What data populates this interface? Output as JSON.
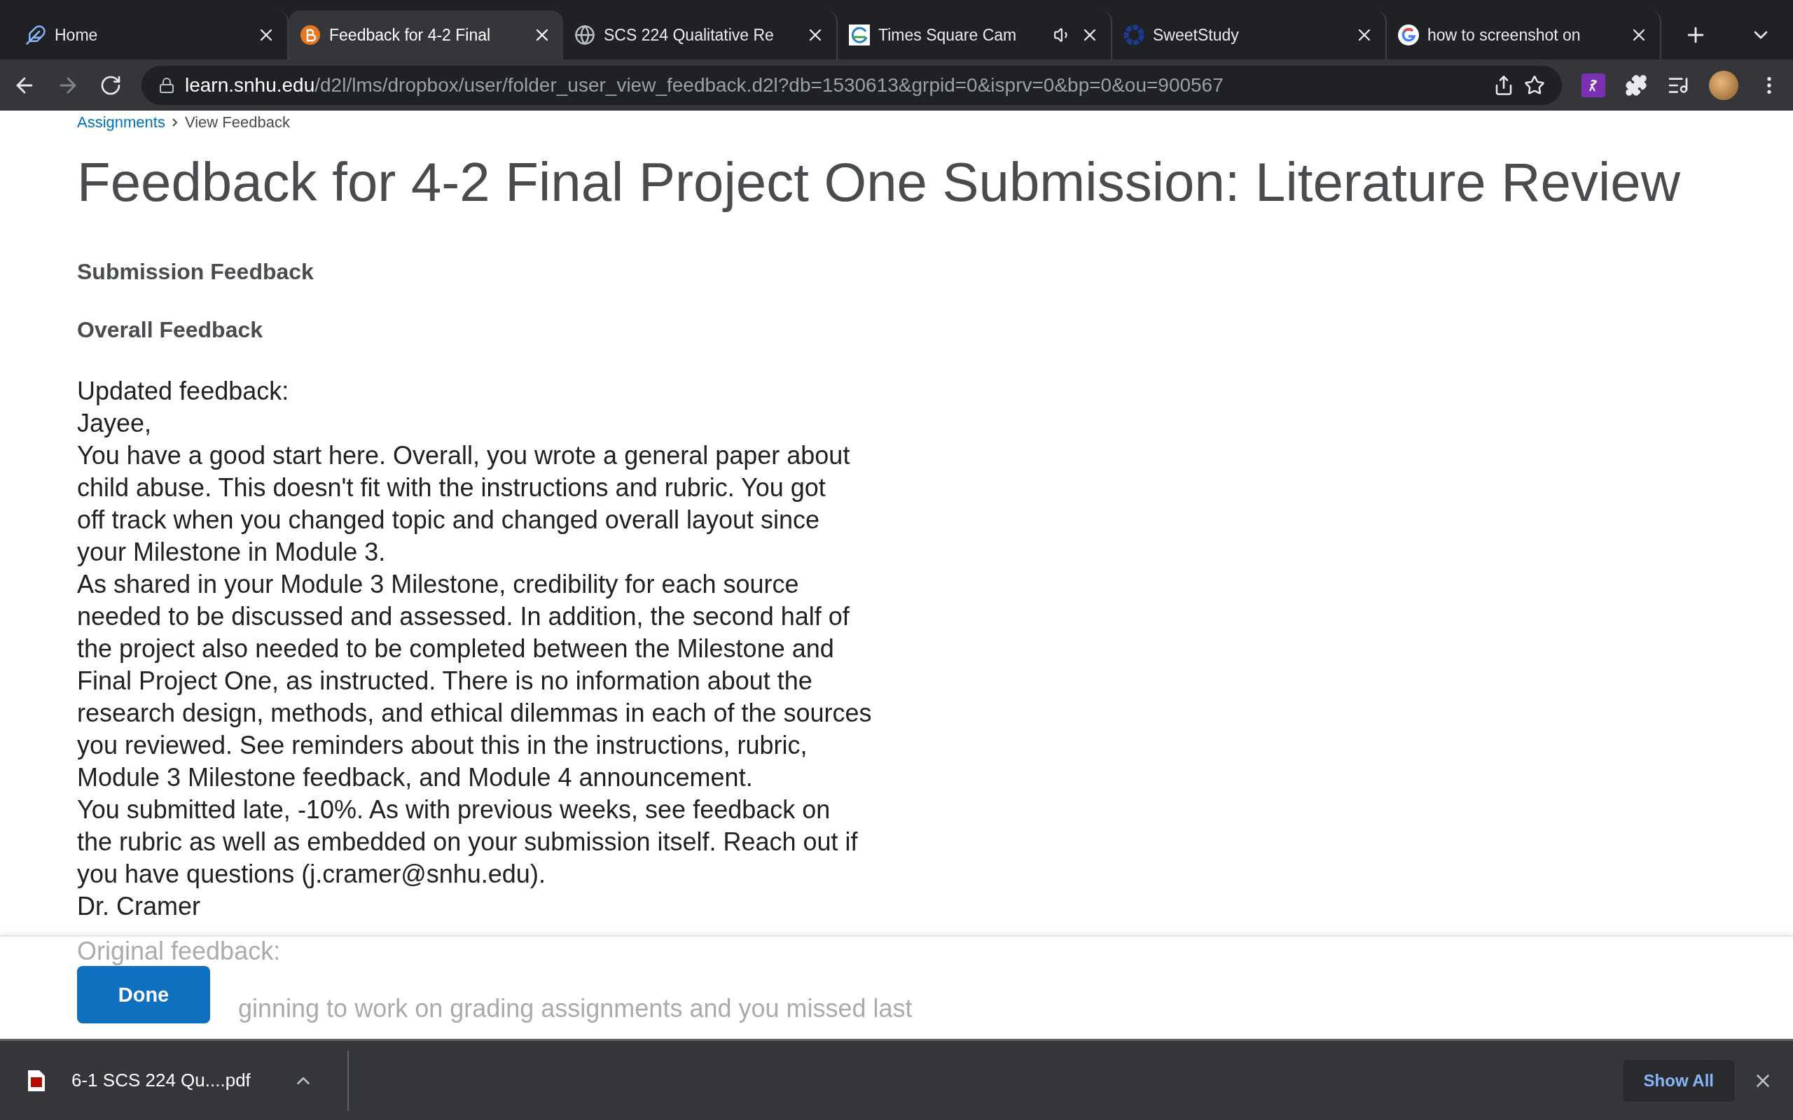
{
  "tabs": [
    {
      "title": "Home",
      "selected": false,
      "audio": false
    },
    {
      "title": "Feedback for 4-2 Final",
      "selected": true,
      "audio": false
    },
    {
      "title": "SCS 224 Qualitative Re",
      "selected": false,
      "audio": false
    },
    {
      "title": "Times Square Cam",
      "selected": false,
      "audio": true
    },
    {
      "title": "SweetStudy",
      "selected": false,
      "audio": false
    },
    {
      "title": "how to screenshot on",
      "selected": false,
      "audio": false
    }
  ],
  "address_bar": {
    "host": "learn.snhu.edu",
    "path": "/d2l/lms/dropbox/user/folder_user_view_feedback.d2l?db=1530613&grpid=0&isprv=0&bp=0&ou=900567"
  },
  "breadcrumb": {
    "link": "Assignments",
    "current": "View Feedback"
  },
  "page_title": "Feedback for 4-2 Final Project One Submission: Literature Review",
  "section_heading": "Submission Feedback",
  "subheading": "Overall Feedback",
  "feedback_lines": [
    "Updated feedback:",
    "Jayee,",
    "You have a good start here.  Overall, you wrote a general paper about",
    "child abuse.  This doesn't fit with the instructions and rubric.  You got",
    "off track when you changed topic and changed overall layout since",
    "your Milestone in Module 3.",
    "As shared in your Module 3 Milestone, credibility for each source",
    "needed to be discussed and assessed.  In addition, the second half of",
    "the project also needed to be completed between the Milestone and",
    "Final Project One, as instructed.  There is no information about the",
    "research design, methods, and ethical dilemmas in each of the sources",
    "you reviewed.  See reminders about this in the instructions, rubric,",
    "Module 3 Milestone feedback, and Module 4 announcement.",
    "You submitted late, -10%.  As with previous weeks, see feedback on",
    "the rubric as well as embedded on your submission itself.  Reach out if",
    "you have questions (j.cramer@snhu.edu).",
    "Dr. Cramer"
  ],
  "faded_lines": [
    "Original feedback:",
    "ginning to work on grading assignments and you missed last"
  ],
  "done_button": "Done",
  "downloads": {
    "file": "6-1 SCS 224 Qu....pdf",
    "show_all": "Show All"
  }
}
